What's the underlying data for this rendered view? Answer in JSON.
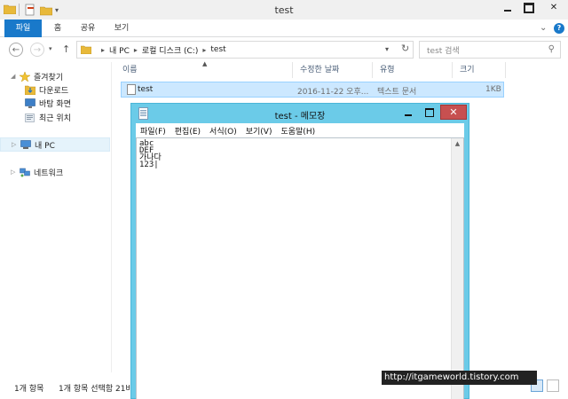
{
  "explorer": {
    "window_title": "test",
    "ribbon_tabs": [
      "파일",
      "홈",
      "공유",
      "보기"
    ],
    "address": {
      "crumbs": [
        "내 PC",
        "로컬 디스크 (C:)",
        "test"
      ],
      "separator": "▸"
    },
    "search": {
      "placeholder": "test 검색"
    },
    "sidebar": {
      "favorites": "즐겨찾기",
      "downloads": "다운로드",
      "desktop": "바탕 화면",
      "recent": "최근 위치",
      "this_pc": "내 PC",
      "network": "네트워크"
    },
    "columns": {
      "name": "이름",
      "date": "수정한 날짜",
      "type": "유형",
      "size": "크기"
    },
    "files": [
      {
        "name": "test",
        "date": "2016-11-22 오후...",
        "type": "텍스트 문서",
        "size": "1KB"
      }
    ],
    "status": {
      "count": "1개 항목",
      "selected": "1개 항목 선택함 21바"
    }
  },
  "notepad": {
    "title": "test - 메모장",
    "menus": [
      "파일(F)",
      "편집(E)",
      "서식(O)",
      "보기(V)",
      "도움말(H)"
    ],
    "content": "abc\nDEF\n가나다\n123|"
  },
  "watermark": "http://itgameworld.tistory.com",
  "colors": {
    "accent": "#1979ca",
    "notepad_frame": "#6bcbe8",
    "close_button": "#c75050",
    "selection": "#cce8ff"
  },
  "icons": {
    "folder": "folder-icon",
    "star": "star-icon",
    "download": "download-folder-icon",
    "desktop": "desktop-icon",
    "recent": "recent-places-icon",
    "pc": "computer-icon",
    "network": "network-icon",
    "file": "text-file-icon",
    "search": "search-icon",
    "refresh": "refresh-icon"
  }
}
